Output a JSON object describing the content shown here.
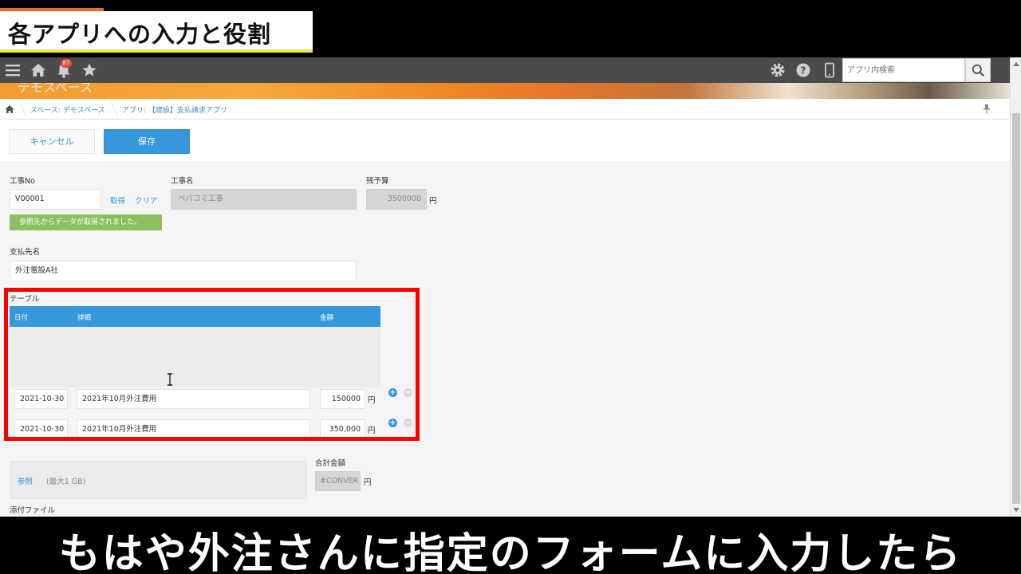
{
  "caption": {
    "top_title": "各アプリへの入力と役割",
    "bottom_subtitle": "もはや外注さんに指定のフォームに入力したら"
  },
  "header": {
    "notification_count": "87",
    "search_placeholder": "アプリ内検索",
    "icons": [
      "menu-icon",
      "home-icon",
      "bell-icon",
      "star-icon",
      "gear-icon",
      "help-icon",
      "mobile-icon",
      "search-icon"
    ]
  },
  "banner": {
    "space_label": "デモスペース"
  },
  "breadcrumb": {
    "space": "スペース: デモスペース",
    "app": "アプリ: 【建設】支払請求アプリ"
  },
  "actions": {
    "cancel_label": "キャンセル",
    "save_label": "保存"
  },
  "form": {
    "project_no": {
      "label": "工事No",
      "value": "V00001",
      "fetch_label": "取得",
      "clear_label": "クリア",
      "notice": "参照先からデータが取得されました。"
    },
    "project_name": {
      "label": "工事名",
      "value": "ペパコミ工事"
    },
    "remaining_budget": {
      "label": "残予算",
      "value": "3500000",
      "unit": "円"
    },
    "payee": {
      "label": "支払先名",
      "value": "外注電設A社"
    },
    "table": {
      "label": "テーブル",
      "columns": [
        "日付",
        "詳細",
        "金額"
      ],
      "rows": [
        {
          "date": "2021-10-30",
          "detail": "2021年10月外注費用",
          "amount": "150000",
          "unit": "円"
        },
        {
          "date": "2021-10-30",
          "detail": "2021年10月外注費用",
          "amount": "350,000",
          "unit": "円"
        }
      ]
    },
    "total": {
      "label": "合計金額",
      "value": "#CONVER",
      "unit": "円"
    },
    "attachment": {
      "label": "添付ファイル",
      "browse_label": "参照",
      "limit": "(最大1 GB)"
    }
  },
  "colors": {
    "accent_blue": "#3498db",
    "notice_green": "#8cbf60",
    "highlight_red": "#ff0000",
    "header_gray": "#4b4b4b"
  }
}
